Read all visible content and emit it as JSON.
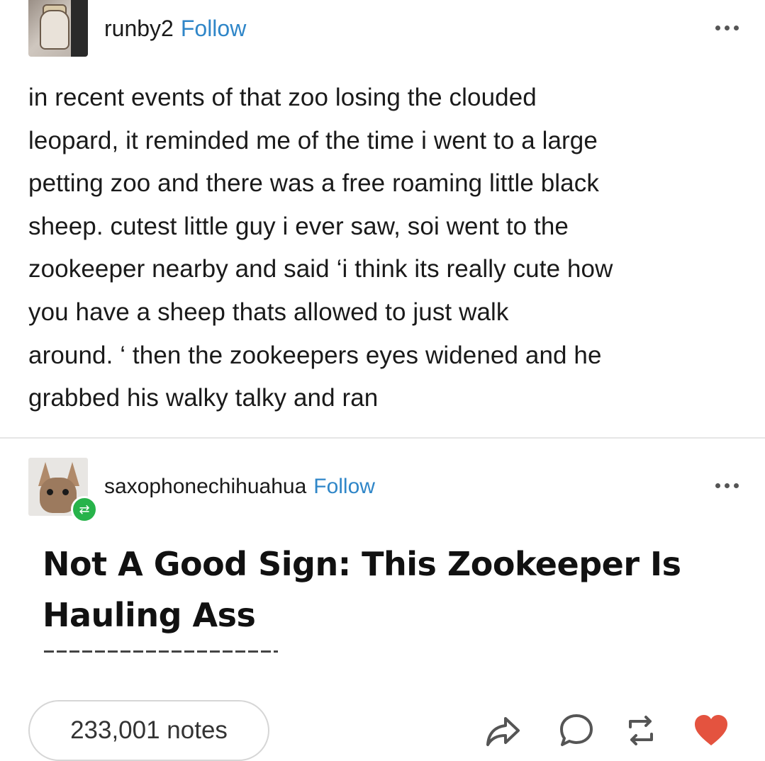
{
  "post": {
    "username": "runby2",
    "follow_label": "Follow",
    "text_lines": [
      "in recent events of that zoo losing the clouded",
      "leopard, it reminded me of the time i went to a large",
      "petting zoo and there was a free roaming little black",
      "sheep. cutest little guy i ever saw, soi went to the",
      "zookeeper nearby and said ‘i think its really cute how",
      "you have a sheep thats allowed to just walk",
      "around. ‘ then the zookeepers eyes widened and he",
      "grabbed his walky talky and ran"
    ]
  },
  "reblog": {
    "username": "saxophonechihuahua",
    "follow_label": "Follow",
    "headline_lines": [
      "Not A Good Sign: This Zookeeper Is",
      "Hauling Ass"
    ]
  },
  "footer": {
    "notes_label": "233,001 notes"
  },
  "icons": {
    "more": "more-icon",
    "share": "share-icon",
    "comment": "comment-icon",
    "reblog": "reblog-icon",
    "like": "heart-icon"
  },
  "colors": {
    "follow": "#2f86c8",
    "reblog_badge": "#27b34a",
    "heart": "#e4533f"
  }
}
